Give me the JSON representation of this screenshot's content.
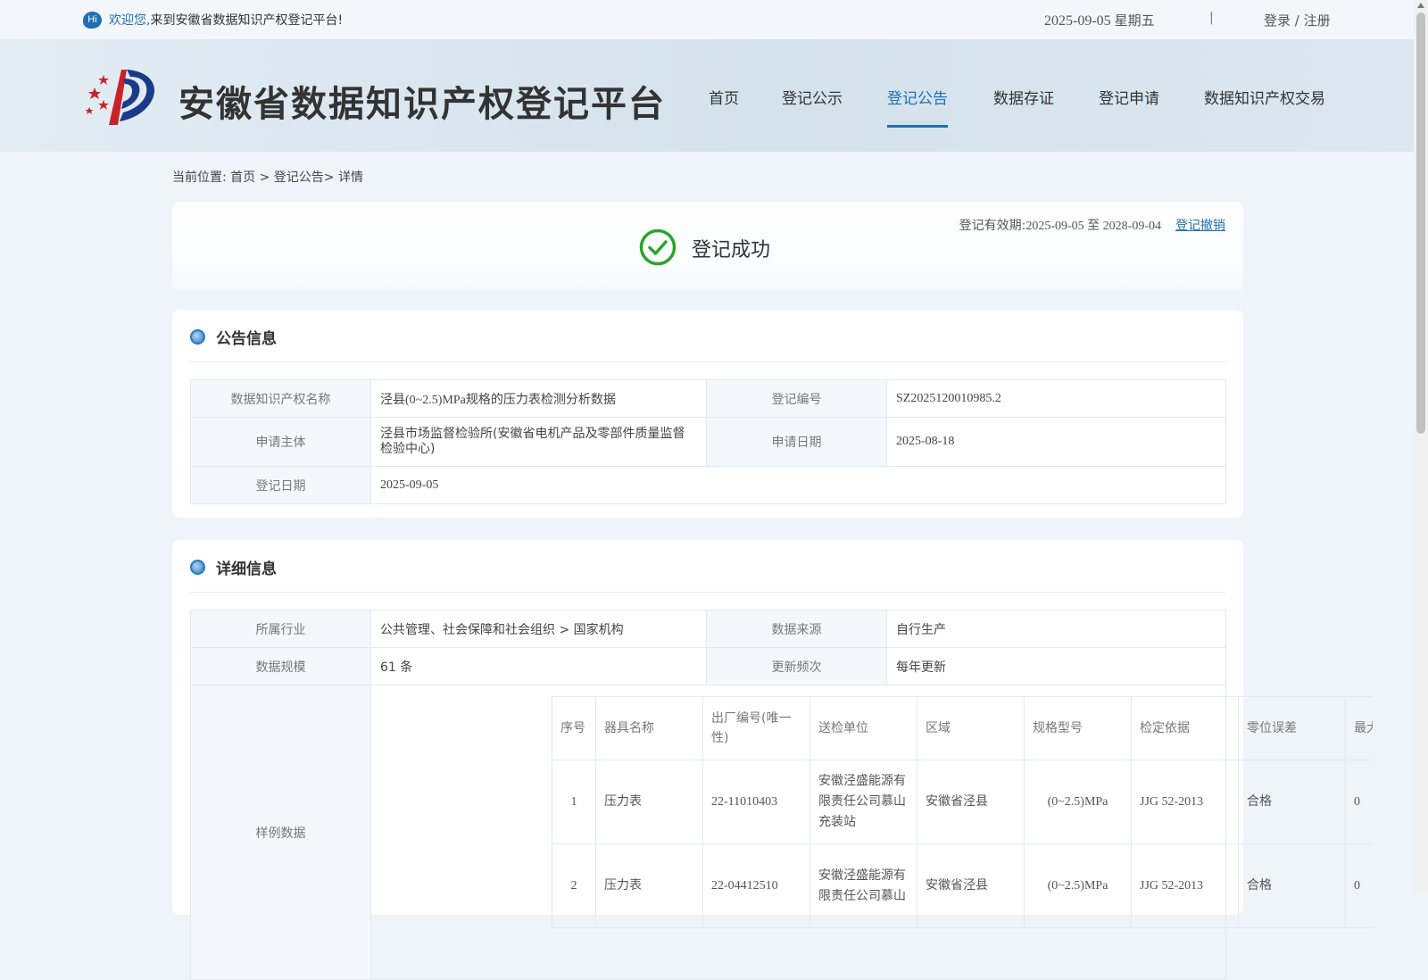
{
  "topbar": {
    "hi_icon": "Hi",
    "welcome_prefix": "欢迎您,",
    "welcome_rest": "来到安徽省数据知识产权登记平台!",
    "date": "2025-09-05",
    "weekday": "星期五",
    "separator": "|",
    "login": "登录 / 注册"
  },
  "header": {
    "site_title": "安徽省数据知识产权登记平台",
    "nav": [
      "首页",
      "登记公示",
      "登记公告",
      "数据存证",
      "登记申请",
      "数据知识产权交易"
    ],
    "active_nav": "登记公告"
  },
  "breadcrumb": "当前位置: 首页 > 登记公告> 详情",
  "status": {
    "validity_label": "登记有效期:",
    "validity_value": "2025-09-05 至 2028-09-04",
    "revoke": "登记撤销",
    "success_text": "登记成功",
    "success_color": "#2aa52a"
  },
  "announcement": {
    "title": "公告信息",
    "rows": {
      "name_label": "数据知识产权名称",
      "name_value": "泾县(0~2.5)MPa规格的压力表检测分析数据",
      "reg_no_label": "登记编号",
      "reg_no_value": "SZ2025120010985.2",
      "applicant_label": "申请主体",
      "applicant_value": "泾县市场监督检验所(安徽省电机产品及零部件质量监督检验中心)",
      "apply_date_label": "申请日期",
      "apply_date_value": "2025-08-18",
      "reg_date_label": "登记日期",
      "reg_date_value": "2025-09-05"
    }
  },
  "detail": {
    "title": "详细信息",
    "rows": {
      "industry_label": "所属行业",
      "industry_value": "公共管理、社会保障和社会组织 > 国家机构",
      "source_label": "数据来源",
      "source_value": "自行生产",
      "scale_label": "数据规模",
      "scale_value": "61 条",
      "freq_label": "更新频次",
      "freq_value": "每年更新",
      "sample_label": "样例数据"
    },
    "sample_table": {
      "headers": [
        "序号",
        "器具名称",
        "出厂编号(唯一性)",
        "送检单位",
        "区域",
        "规格型号",
        "检定依据",
        "零位误差",
        "最大(±"
      ],
      "rows": [
        [
          "1",
          "压力表",
          "22-11010403",
          "安徽泾盛能源有限责任公司慕山充装站",
          "安徽省泾县",
          "(0~2.5)MPa",
          "JJG 52-2013",
          "合格",
          "0"
        ],
        [
          "2",
          "压力表",
          "22-04412510",
          "安徽泾盛能源有限责任公司慕山",
          "安徽省泾县",
          "(0~2.5)MPa",
          "JJG 52-2013",
          "合格",
          "0"
        ]
      ]
    }
  },
  "colors": {
    "accent": "#1f6fb5",
    "page_bg": "#eef4fa"
  }
}
